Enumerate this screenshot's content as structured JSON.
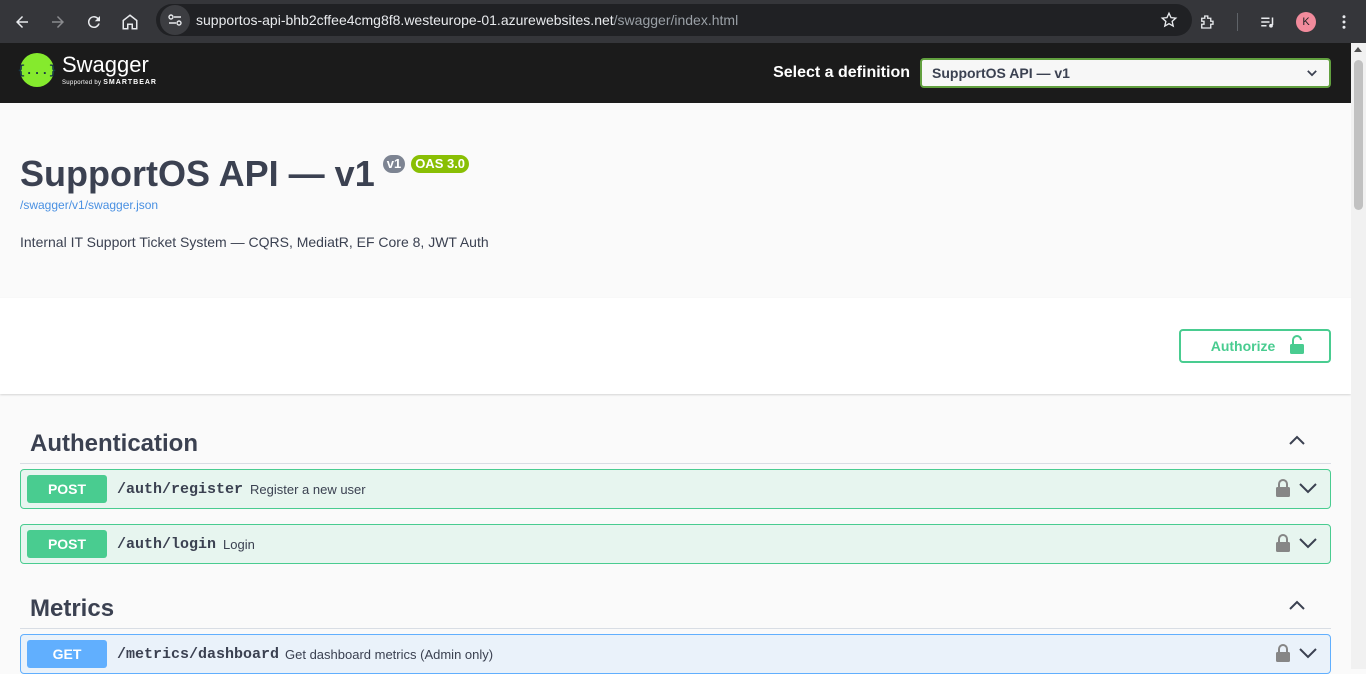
{
  "browser": {
    "url_host": "supportos-api-bhb2cffee4cmg8f8.westeurope-01.azurewebsites.net",
    "url_path": "/swagger/index.html",
    "profile_initial": "K",
    "icons": [
      "back-arrow-icon",
      "forward-arrow-icon",
      "reload-icon",
      "home-icon",
      "site-info-icon",
      "star-icon",
      "extensions-icon",
      "media-controls-icon",
      "more-menu-icon"
    ]
  },
  "topbar": {
    "logo_title": "Swagger",
    "logo_sub_prefix": "Supported by",
    "logo_sub_brand": "SMARTBEAR",
    "logo_glyph": "{...}",
    "definition_label": "Select a definition",
    "definition_selected": "SupportOS API — v1"
  },
  "info": {
    "title": "SupportOS API — v1",
    "version_badge": "v1",
    "oas_badge": "OAS 3.0",
    "json_link": "/swagger/v1/swagger.json",
    "description": "Internal IT Support Ticket System — CQRS, MediatR, EF Core 8, JWT Auth"
  },
  "scheme": {
    "authorize_label": "Authorize"
  },
  "tags": [
    {
      "name": "Authentication",
      "operations": [
        {
          "method": "POST",
          "path": "/auth/register",
          "summary": "Register a new user"
        },
        {
          "method": "POST",
          "path": "/auth/login",
          "summary": "Login"
        }
      ]
    },
    {
      "name": "Metrics",
      "operations": [
        {
          "method": "GET",
          "path": "/metrics/dashboard",
          "summary": "Get dashboard metrics (Admin only)"
        }
      ]
    }
  ],
  "colors": {
    "post": "#49cc90",
    "get": "#61affe",
    "swagger_green": "#85ea2d",
    "topbar_bg": "#1b1b1b",
    "text": "#3b4151"
  }
}
